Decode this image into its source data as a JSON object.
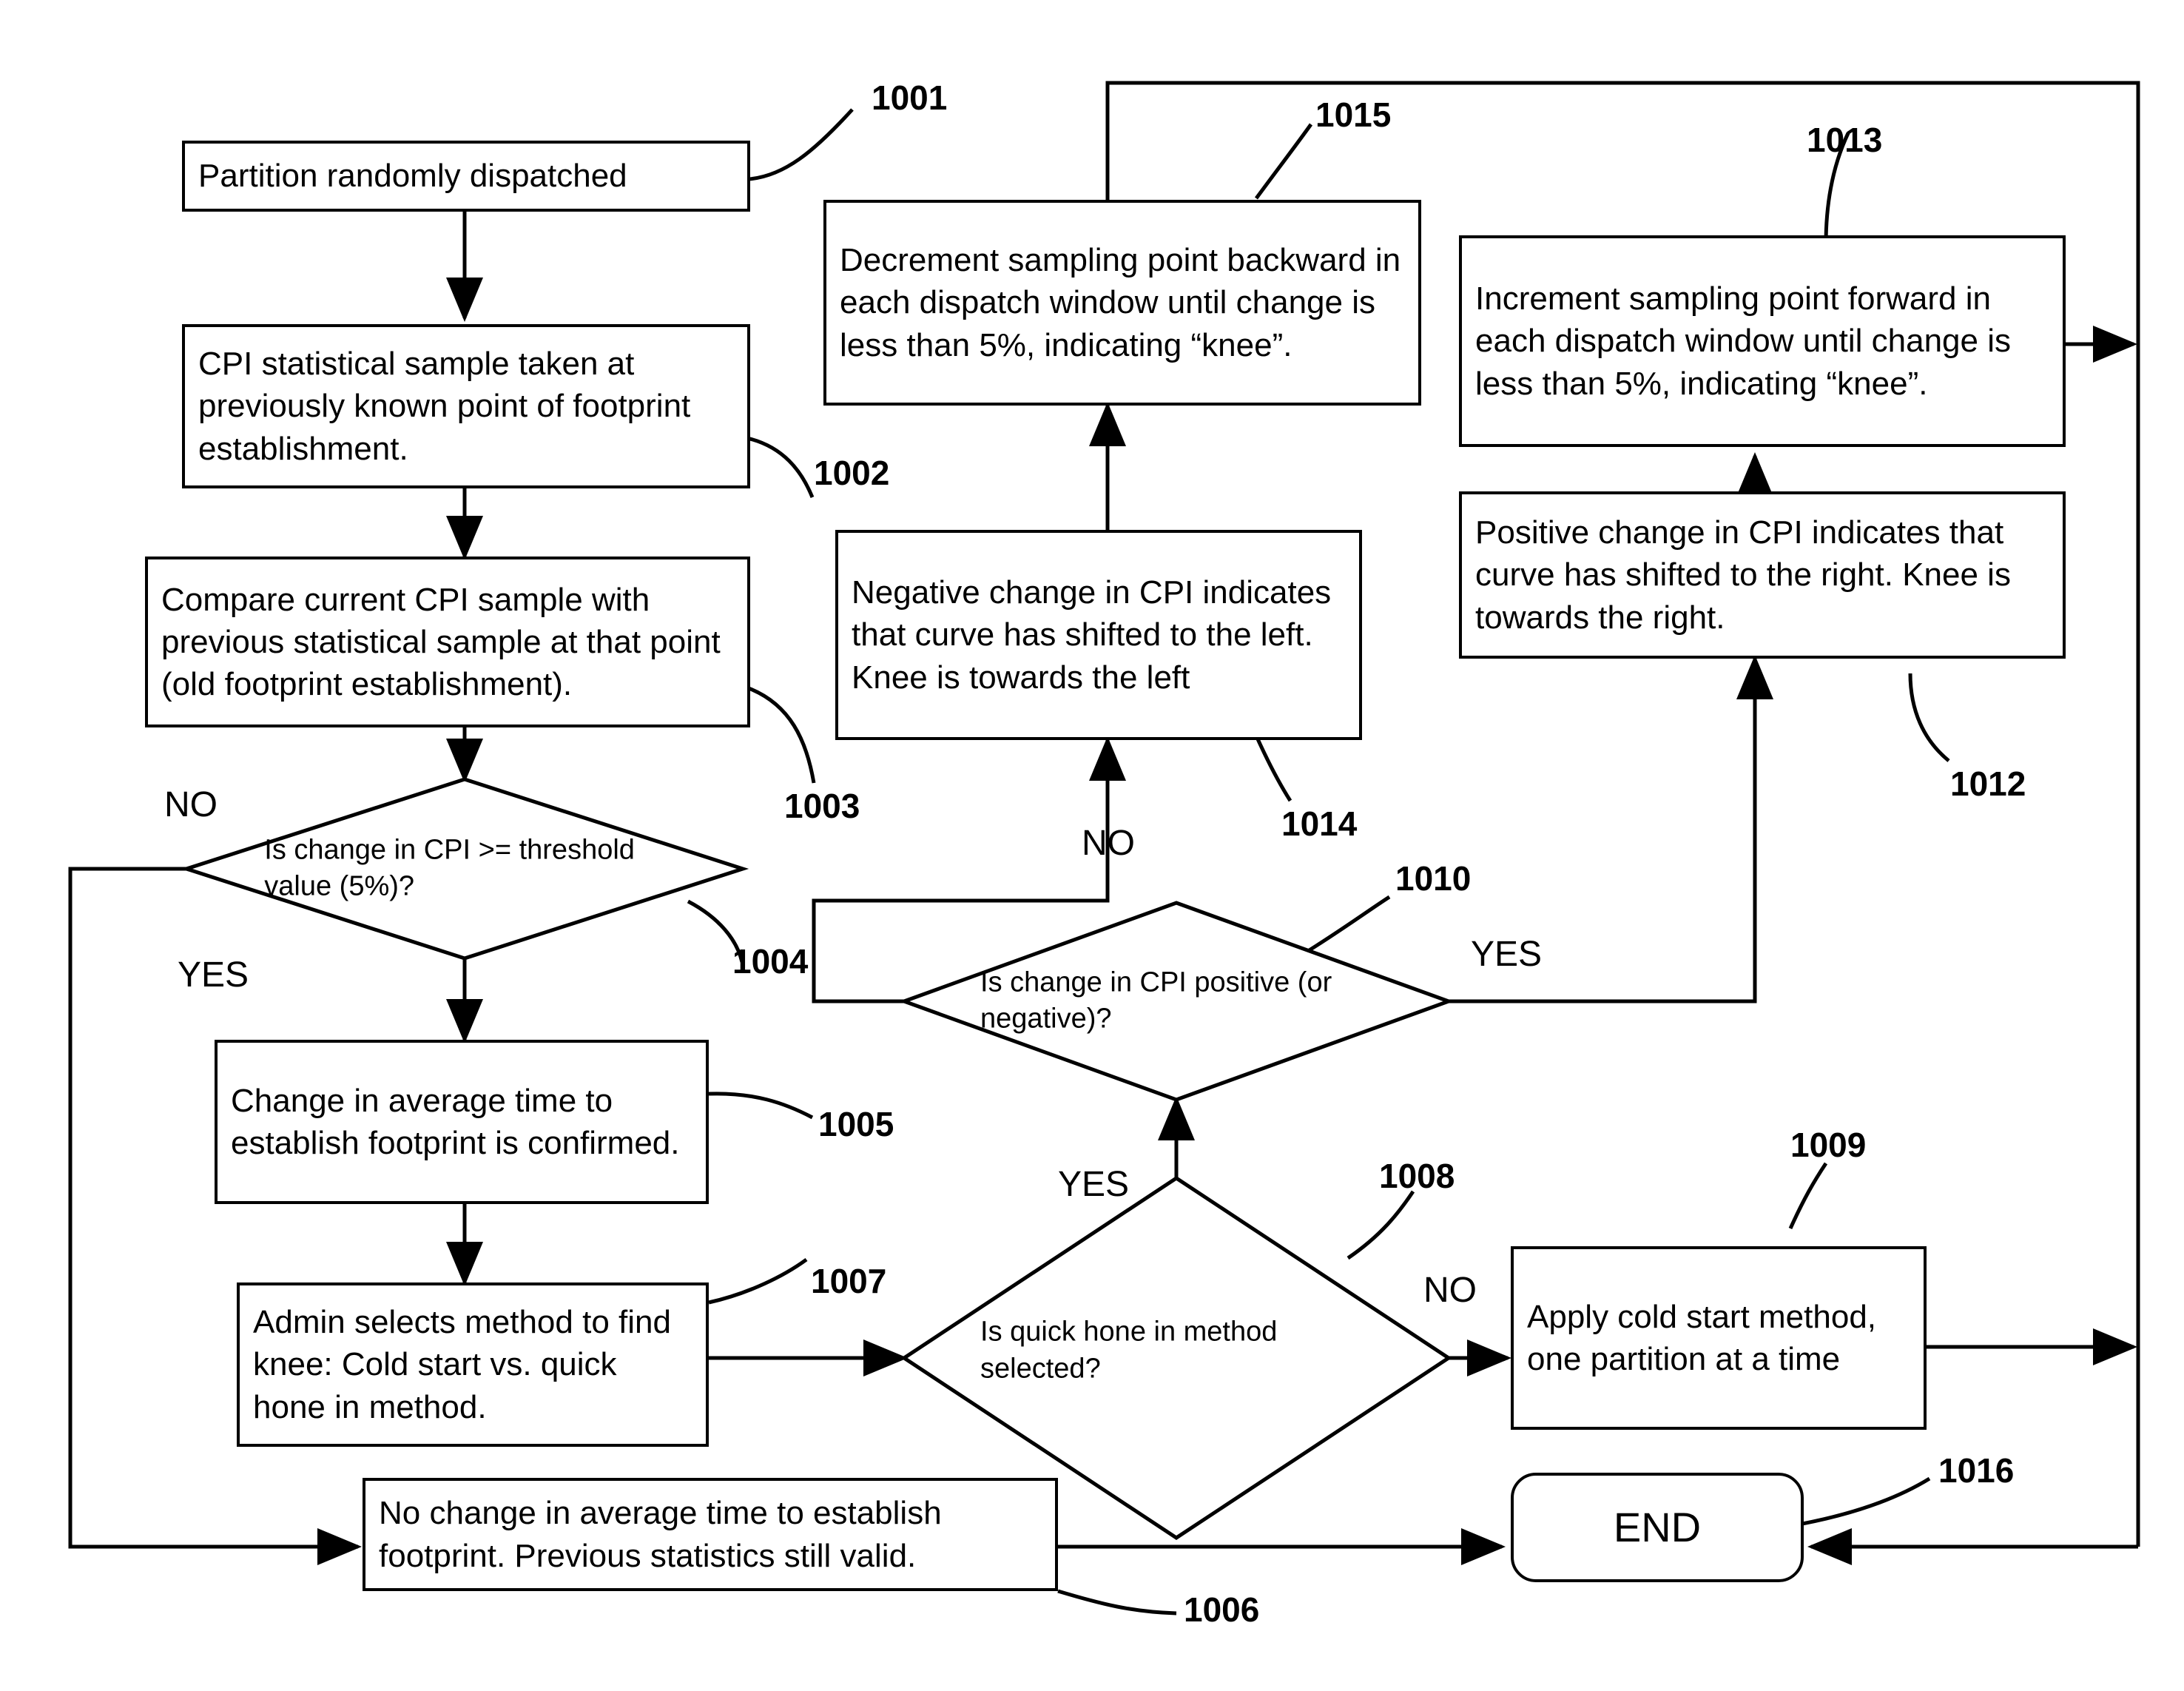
{
  "figure": {
    "type": "patent-flowchart",
    "background_color": "#ffffff",
    "line_color": "#000000"
  },
  "nodes": {
    "n1001": {
      "ref": "1001",
      "text": "Partition randomly dispatched",
      "shape": "process"
    },
    "n1002": {
      "ref": "1002",
      "text": "CPI statistical sample taken at previously known point of footprint establishment.",
      "shape": "process"
    },
    "n1003": {
      "ref": "1003",
      "text": "Compare current CPI sample with previous statistical sample at that point (old footprint establishment).",
      "shape": "process"
    },
    "n1004": {
      "ref": "1004",
      "text": "Is change in CPI >= threshold value (5%)?",
      "shape": "decision"
    },
    "n1005": {
      "ref": "1005",
      "text": "Change in average time to establish footprint is confirmed.",
      "shape": "process"
    },
    "n1006": {
      "ref": "1006",
      "text": "No change in average time to establish footprint.  Previous statistics still valid.",
      "shape": "process"
    },
    "n1007": {
      "ref": "1007",
      "text": "Admin selects method to find knee: Cold start vs. quick hone in method.",
      "shape": "process"
    },
    "n1008": {
      "ref": "1008",
      "text": "Is quick hone in method selected?",
      "shape": "decision"
    },
    "n1009": {
      "ref": "1009",
      "text": "Apply cold start method, one partition at a time",
      "shape": "process"
    },
    "n1010": {
      "ref": "1010",
      "text": "Is change in CPI positive (or negative)?",
      "shape": "decision"
    },
    "n1012": {
      "ref": "1012",
      "text": "Positive change in CPI indicates that curve has shifted to the right.  Knee is towards the right.",
      "shape": "process"
    },
    "n1013": {
      "ref": "1013",
      "text": "Increment  sampling point forward in each dispatch window until change is less than 5%, indicating “knee”.",
      "shape": "process"
    },
    "n1014": {
      "ref": "1014",
      "text": "Negative change in CPI indicates that curve has shifted to the left.  Knee is towards the left",
      "shape": "process"
    },
    "n1015": {
      "ref": "1015",
      "text": "Decrement  sampling point backward in each dispatch window until change is less than 5%, indicating “knee”.",
      "shape": "process"
    },
    "n1016": {
      "ref": "1016",
      "text": "END",
      "shape": "terminal"
    }
  },
  "branch_labels": {
    "d1004_no": "NO",
    "d1004_yes": "YES",
    "d1008_yes": "YES",
    "d1008_no": "NO",
    "d1010_no": "NO",
    "d1010_yes": "YES"
  },
  "reference_numerals": [
    "1001",
    "1002",
    "1003",
    "1004",
    "1005",
    "1006",
    "1007",
    "1008",
    "1009",
    "1010",
    "1012",
    "1013",
    "1014",
    "1015",
    "1016"
  ]
}
